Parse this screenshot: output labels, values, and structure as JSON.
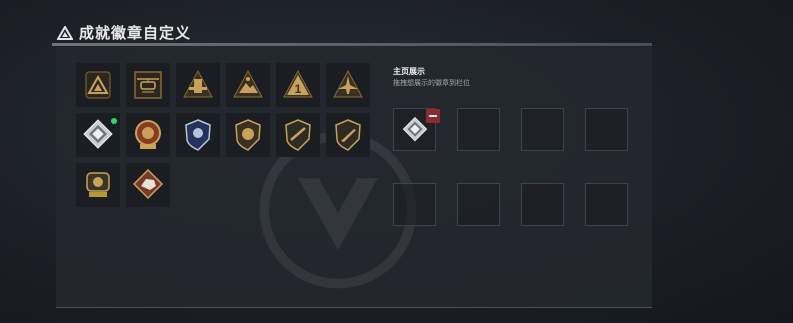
{
  "header": {
    "title": "成就徽章自定义",
    "icon": "achievement-triangle-icon"
  },
  "showcase": {
    "title": "主页展示",
    "subtitle": "拖拽想展示的徽章到栏位"
  },
  "badges": [
    {
      "icon": "triangle-badge-icon",
      "new": false
    },
    {
      "icon": "helicopter-badge-icon",
      "new": false
    },
    {
      "icon": "tower-badge-icon",
      "new": false
    },
    {
      "icon": "mountain-badge-icon",
      "new": false
    },
    {
      "icon": "number-one-badge-icon",
      "new": false
    },
    {
      "icon": "jet-badge-icon",
      "new": false
    },
    {
      "icon": "diamond-plate-badge-icon",
      "new": true
    },
    {
      "icon": "medal-badge-icon",
      "new": false
    },
    {
      "icon": "police-shield-badge-icon",
      "new": false
    },
    {
      "icon": "lion-shield-badge-icon",
      "new": false
    },
    {
      "icon": "rifle-shield-badge-icon",
      "new": false
    },
    {
      "icon": "knife-shield-badge-icon",
      "new": false
    },
    {
      "icon": "crest-badge-icon",
      "new": false
    },
    {
      "icon": "beast-badge-icon",
      "new": false
    }
  ],
  "slots": [
    {
      "filled": true,
      "icon": "diamond-plate-badge-icon"
    },
    {
      "filled": false
    },
    {
      "filled": false
    },
    {
      "filled": false
    },
    {
      "filled": false
    },
    {
      "filled": false
    },
    {
      "filled": false
    },
    {
      "filled": false
    }
  ],
  "colors": {
    "gold": "#c8a25a",
    "dark_gold": "#8a6a32",
    "remove": "#8e2a2f",
    "new_dot": "#35d46a"
  }
}
